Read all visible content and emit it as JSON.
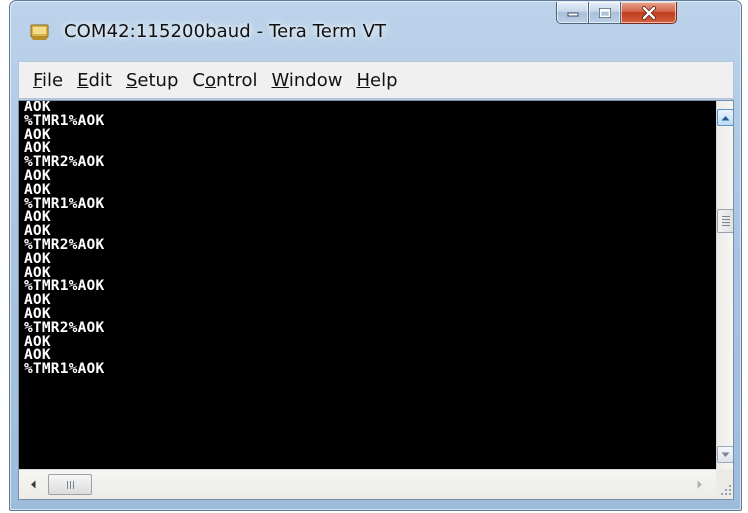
{
  "window": {
    "title": "COM42:115200baud - Tera Term VT",
    "app_icon": "tera-term-app-icon",
    "caption_buttons": [
      "minimize-icon",
      "maximize-icon",
      "close-icon"
    ]
  },
  "menu": {
    "items": [
      {
        "accel": "F",
        "rest": "ile"
      },
      {
        "accel": "E",
        "rest": "dit"
      },
      {
        "accel": "S",
        "rest": "etup"
      },
      {
        "pre": "C",
        "accel": "o",
        "rest": "ntrol"
      },
      {
        "accel": "W",
        "rest": "indow"
      },
      {
        "accel": "H",
        "rest": "elp"
      }
    ]
  },
  "terminal": {
    "background": "#000000",
    "foreground": "#ffffff",
    "lines": [
      "AOK",
      "%TMR1%AOK",
      "AOK",
      "AOK",
      "%TMR2%AOK",
      "AOK",
      "AOK",
      "%TMR1%AOK",
      "AOK",
      "AOK",
      "%TMR2%AOK",
      "AOK",
      "AOK",
      "%TMR1%AOK",
      "AOK",
      "AOK",
      "%TMR2%AOK",
      "AOK",
      "AOK",
      "%TMR1%AOK"
    ]
  },
  "scrollbars": {
    "vertical_position": 0.3,
    "horizontal_position": 0.0
  }
}
